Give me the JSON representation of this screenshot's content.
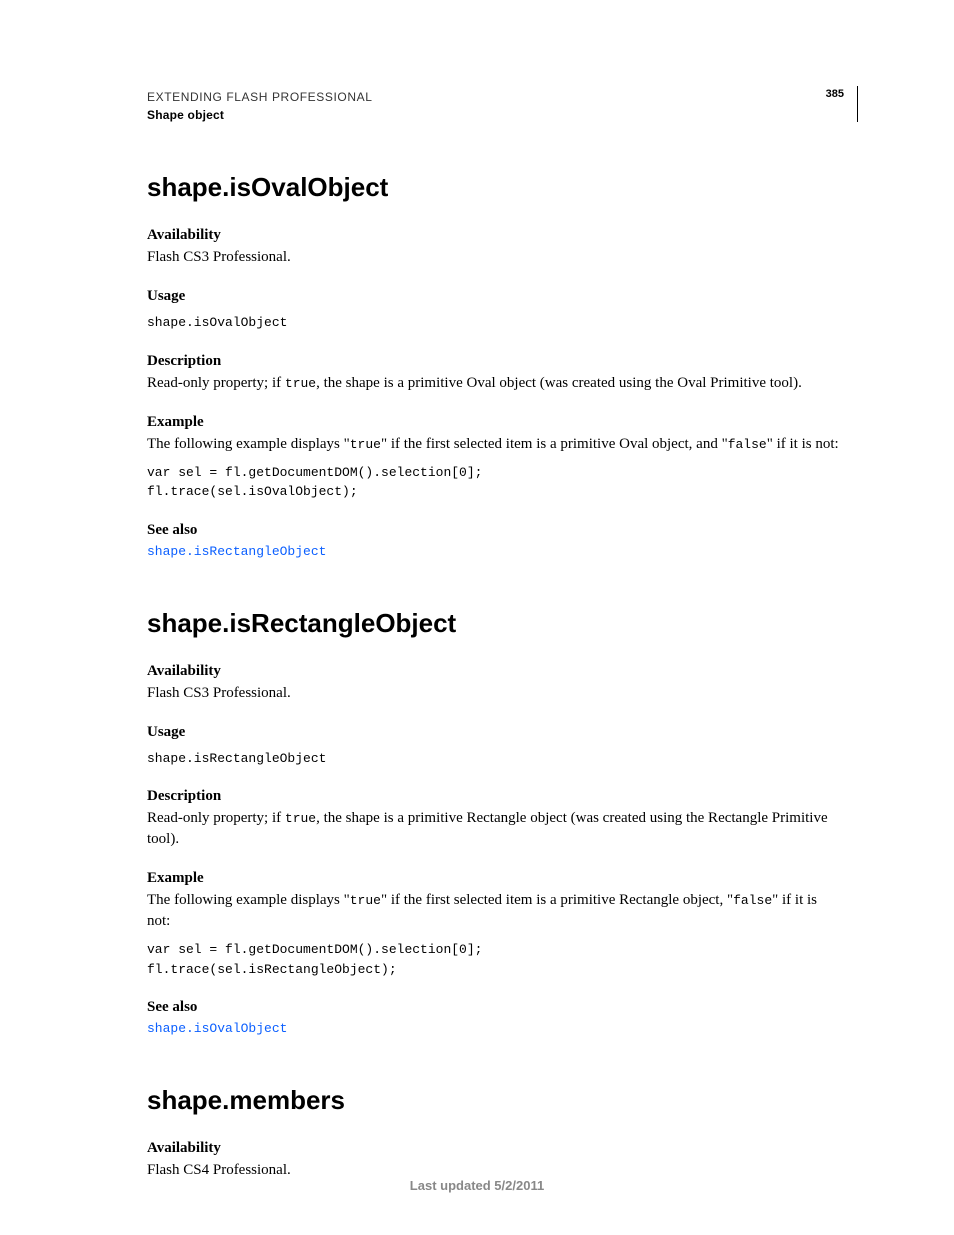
{
  "header": {
    "title": "EXTENDING FLASH PROFESSIONAL",
    "subtitle": "Shape object",
    "pageNumber": "385"
  },
  "sections": [
    {
      "title": "shape.isOvalObject",
      "availability": {
        "label": "Availability",
        "text": "Flash CS3 Professional."
      },
      "usage": {
        "label": "Usage",
        "code": "shape.isOvalObject"
      },
      "description": {
        "label": "Description",
        "pre": "Read-only property; if ",
        "inline": "true",
        "post": ", the shape is a primitive Oval object (was created using the Oval Primitive tool)."
      },
      "example": {
        "label": "Example",
        "pre": "The following example displays \"",
        "inline1": "true",
        "mid": "\" if the first selected item is a primitive Oval object, and \"",
        "inline2": "false",
        "post": "\" if it is not:",
        "code": "var sel = fl.getDocumentDOM().selection[0];\nfl.trace(sel.isOvalObject);"
      },
      "seeAlso": {
        "label": "See also",
        "link": "shape.isRectangleObject"
      }
    },
    {
      "title": "shape.isRectangleObject",
      "availability": {
        "label": "Availability",
        "text": "Flash CS3 Professional."
      },
      "usage": {
        "label": "Usage",
        "code": "shape.isRectangleObject"
      },
      "description": {
        "label": "Description",
        "pre": "Read-only property; if ",
        "inline": "true",
        "post": ", the shape is a primitive Rectangle object (was created using the Rectangle Primitive tool)."
      },
      "example": {
        "label": "Example",
        "pre": "The following example displays \"",
        "inline1": "true",
        "mid": "\" if the first selected item is a primitive Rectangle object, \"",
        "inline2": "false",
        "post": "\" if it is not:",
        "code": "var sel = fl.getDocumentDOM().selection[0];\nfl.trace(sel.isRectangleObject);"
      },
      "seeAlso": {
        "label": "See also",
        "link": "shape.isOvalObject"
      }
    },
    {
      "title": "shape.members",
      "availability": {
        "label": "Availability",
        "text": "Flash CS4 Professional."
      }
    }
  ],
  "footer": "Last updated 5/2/2011"
}
